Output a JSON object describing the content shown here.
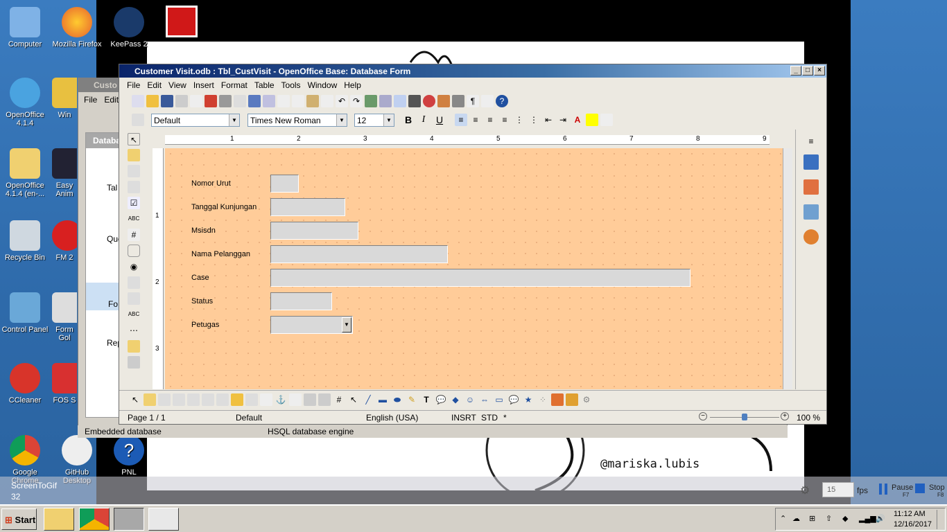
{
  "desktop": {
    "icons_col1": [
      "Computer",
      "OpenOffice 4.1.4",
      "OpenOffice 4.1.4 (en-...",
      "Recycle Bin",
      "Control Panel",
      "CCleaner",
      "Google Chrome"
    ],
    "icons_col2": [
      "Mozilla Firefox",
      "Win",
      "Easy Anim",
      "FM 2",
      "Form Gol",
      "FOS S",
      "GitHub Desktop"
    ],
    "icons_col3": [
      "KeePass 2",
      "PNL"
    ],
    "photo_watermark": "@mariska.lubis"
  },
  "back_window": {
    "title": "Custo",
    "menu": [
      "File",
      "Edit"
    ],
    "panel_title": "Databa",
    "items": [
      "Tal",
      "Que",
      "Fo",
      "Rep"
    ],
    "status_left": "Embedded database",
    "status_mid": "HSQL database engine"
  },
  "window": {
    "title": "Customer Visit.odb : Tbl_CustVisit - OpenOffice Base: Database Form",
    "menu": [
      "File",
      "Edit",
      "View",
      "Insert",
      "Format",
      "Table",
      "Tools",
      "Window",
      "Help"
    ],
    "paragraph_style": "Default",
    "font_name": "Times New Roman",
    "font_size": "12",
    "ruler_numbers": [
      "1",
      "2",
      "3",
      "4",
      "5",
      "6",
      "7",
      "8",
      "9"
    ],
    "vruler_numbers": [
      "1",
      "2",
      "3"
    ],
    "bold": "B",
    "italic": "I",
    "underline": "U"
  },
  "form": {
    "fields": [
      {
        "label": "Nomor Urut"
      },
      {
        "label": "Tanggal Kunjungan"
      },
      {
        "label": "Msisdn"
      },
      {
        "label": "Nama Pelanggan"
      },
      {
        "label": "Case"
      },
      {
        "label": "Status"
      },
      {
        "label": "Petugas"
      }
    ]
  },
  "statusbar": {
    "page": "Page 1 / 1",
    "style": "Default",
    "language": "English (USA)",
    "insert": "INSRT",
    "std": "STD",
    "modified": "*",
    "zoom": "100 %",
    "zoom_level": 100
  },
  "screentogif": {
    "label": "ScreenToGif",
    "frames": "32",
    "fps_value": "15",
    "fps": "fps",
    "pause": "Pause",
    "pause_key": "F7",
    "stop": "Stop",
    "stop_key": "F8"
  },
  "taskbar": {
    "start": "Start",
    "time": "11:12 AM",
    "date": "12/16/2017"
  },
  "colors": {
    "form_bg": "#ffcc99",
    "titlebar": "#0a246a",
    "desktop": "#2d6ca8"
  }
}
